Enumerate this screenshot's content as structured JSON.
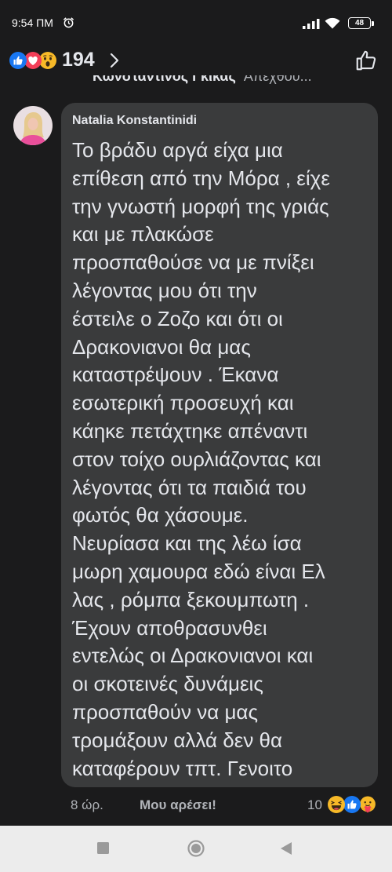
{
  "status_bar": {
    "time": "9:54 ΠΜ",
    "battery_level": "48",
    "icons": [
      "alarm-icon",
      "signal-icon",
      "wifi-icon",
      "battery-icon"
    ]
  },
  "reactions_summary": {
    "count": "194",
    "icons": [
      "like-reaction-icon",
      "love-reaction-icon",
      "wow-reaction-icon",
      "chevron-right-icon"
    ]
  },
  "top_actions": {
    "icons": [
      "like-outline-icon"
    ]
  },
  "previous_comment": {
    "author": "Κωνσταντινος Γκικας",
    "snippet": "Απεχθου..."
  },
  "comment": {
    "author": "Natalia Konstantinidi",
    "lines": [
      "Το βράδυ αργά είχα μια",
      "επίθεση από την Μόρα , είχε",
      "την γνωστή μορφή της γριάς",
      "και με πλακώσε",
      "προσπαθούσε να με πνίξει",
      "λέγοντας μου ότι την",
      "έστειλε ο Ζοζο και ότι οι",
      "Δρακονιανοι θα μας",
      "καταστρέψουν . Έκανα",
      "εσωτερική προσευχή και",
      "κάηκε πετάχτηκε απέναντι",
      "στον τοίχο ουρλιάζοντας και",
      "λέγοντας ότι τα παιδιά του",
      "φωτός θα χάσουμε.",
      "Νευρίασα και της λέω ίσα",
      "μωρη χαμουρα εδώ είναι Ελ",
      "λας , ρόμπα ξεκουμπωτη .",
      "Έχουν αποθρασυνθει",
      "εντελώς οι Δρακονιανοι και",
      "οι σκοτεινές δυνάμεις",
      "προσπαθούν να μας",
      "τρομάξουν αλλά δεν θα",
      "καταφέρουν τπτ. Γενοιτο"
    ],
    "time": "8 ώρ.",
    "like_action": "Μου αρέσει!",
    "reaction_count": "10",
    "reaction_icons": [
      "haha-reaction-icon",
      "like-reaction-icon",
      "care-reaction-icon"
    ]
  },
  "nav_bar": {
    "icons": [
      "recents-icon",
      "home-icon",
      "back-icon"
    ]
  },
  "colors": {
    "background": "#1b1b1c",
    "bubble": "#3a3b3c",
    "text": "#e4e6eb",
    "secondary_text": "#b0b3b8",
    "nav_bar": "#ececec",
    "like_blue": "#1877f2",
    "love_red": "#f33e58",
    "emoji_yellow": "#f7b928"
  }
}
